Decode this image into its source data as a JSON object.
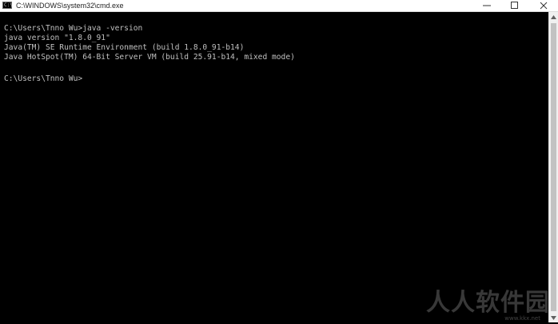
{
  "window": {
    "title": "C:\\WINDOWS\\system32\\cmd.exe",
    "app_icon_glyph": "C:\\",
    "buttons": {
      "minimize": "minimize-icon",
      "maximize": "maximize-icon",
      "close": "close-icon"
    }
  },
  "console": {
    "lines": [
      "C:\\Users\\Tnno Wu>java -version",
      "java version \"1.8.0_91\"",
      "Java(TM) SE Runtime Environment (build 1.8.0_91-b14)",
      "Java HotSpot(TM) 64-Bit Server VM (build 25.91-b14, mixed mode)",
      "",
      "C:\\Users\\Tnno Wu>"
    ],
    "text_color": "#c0c0c0",
    "background": "#000000"
  },
  "watermark": {
    "text": "人人软件园",
    "url": "www.kkx.net"
  }
}
